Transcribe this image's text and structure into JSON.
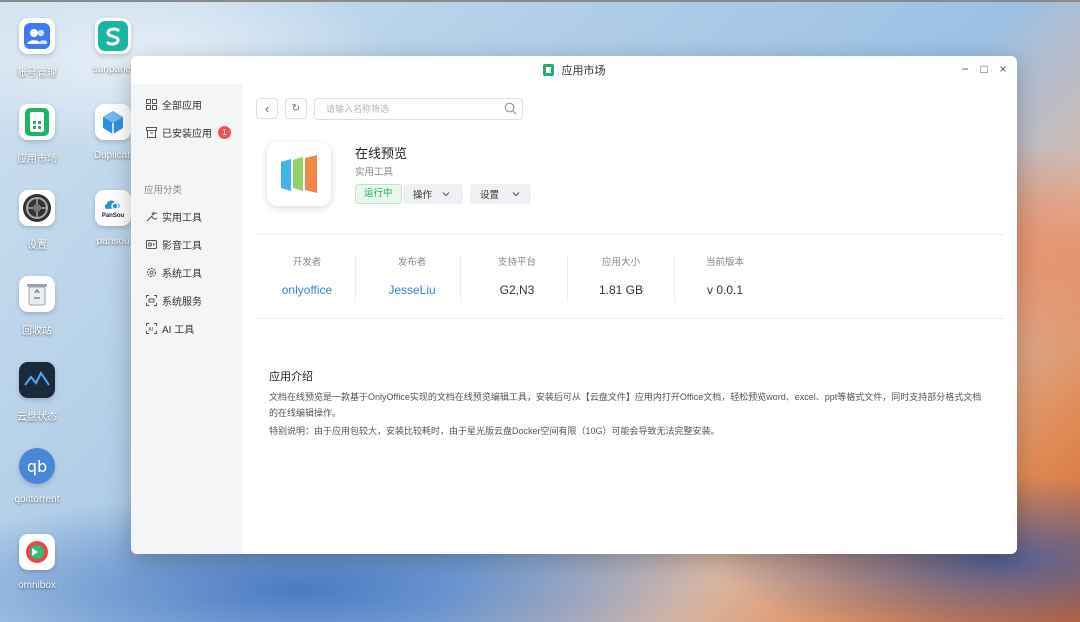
{
  "desktop": {
    "icons": [
      {
        "label": "账号管理",
        "icon": "users-icon"
      },
      {
        "label": "sunpanel",
        "icon": "sunpanel-icon"
      },
      {
        "label": "应用市场",
        "icon": "app-market-icon"
      },
      {
        "label": "Duplicati",
        "icon": "duplicati-icon"
      },
      {
        "label": "设置",
        "icon": "settings-icon"
      },
      {
        "label": "pansou",
        "icon": "pansou-icon"
      },
      {
        "label": "回收站",
        "icon": "recycle-bin-icon"
      },
      {
        "label": "云盘状态",
        "icon": "disk-status-icon"
      },
      {
        "label": "qbittorrent",
        "icon": "qbittorrent-icon"
      },
      {
        "label": "omnibox",
        "icon": "omnibox-icon"
      }
    ],
    "pansou_tile_text": "PanSou",
    "qb_tile_text": "qb"
  },
  "window": {
    "title": "应用市场",
    "controls": {
      "minimize": "−",
      "maximize": "□",
      "close": "×"
    }
  },
  "sidebar": {
    "all_apps": "全部应用",
    "installed": "已安装应用",
    "installed_count": "1",
    "category_header": "应用分类",
    "categories": [
      "实用工具",
      "影音工具",
      "系统工具",
      "系统服务",
      "AI 工具"
    ]
  },
  "toolbar": {
    "back": "‹",
    "refresh": "↻",
    "search_placeholder": "请输入名称筛选"
  },
  "app": {
    "name": "在线预览",
    "category": "实用工具",
    "status": "运行中",
    "action_label": "操作",
    "settings_label": "设置"
  },
  "stats": [
    {
      "key": "开发者",
      "value": "onlyoffice",
      "link": true
    },
    {
      "key": "发布者",
      "value": "JesseLiu",
      "link": true
    },
    {
      "key": "支持平台",
      "value": "G2,N3",
      "link": false
    },
    {
      "key": "应用大小",
      "value": "1.81 GB",
      "link": false
    },
    {
      "key": "当前版本",
      "value": "v 0.0.1",
      "link": false
    }
  ],
  "intro": {
    "title": "应用介绍",
    "paragraph1": "文档在线预览是一款基于OnlyOffice实现的文档在线预览编辑工具，安装后可从【云盘文件】应用内打开Office文档，轻松预览word、excel、ppt等格式文件，同时支持部分格式文档的在线编辑操作。",
    "paragraph2": "特别说明：由于应用包较大，安装比较耗时，由于星光版云盘Docker空间有限（10G）可能会导致无法完整安装。"
  },
  "colors": {
    "accent_green": "#20b26b",
    "link_blue": "#3a86d8",
    "badge_red": "#f05454",
    "status_green": "#2eaa5f"
  }
}
